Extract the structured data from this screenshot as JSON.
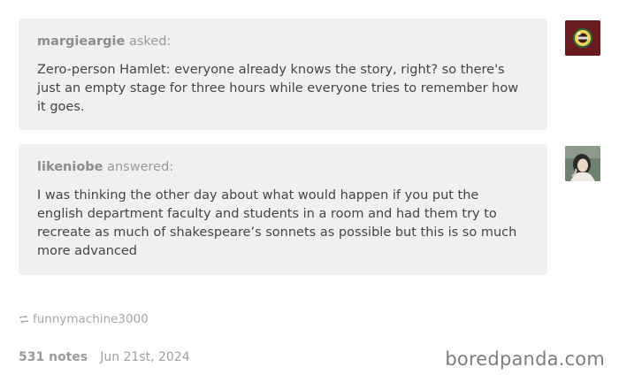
{
  "question": {
    "username": "margieargie",
    "action": "asked:",
    "text": "Zero-person Hamlet: everyone already knows the story, right? so there's just an empty stage for three hours while everyone tries to remember how it goes."
  },
  "answer": {
    "username": "likeniobe",
    "action": "answered:",
    "text": "I was thinking the other day about what would happen if you put the english department faculty and students in a room and had them try to recreate as much of shakespeare’s sonnets as possible but this is so much more advanced"
  },
  "reblog": {
    "icon": "reblog-icon",
    "username": "funnymachine3000"
  },
  "footer": {
    "notes": "531 notes",
    "date": "Jun 21st, 2024"
  },
  "watermark": "boredpanda.com"
}
